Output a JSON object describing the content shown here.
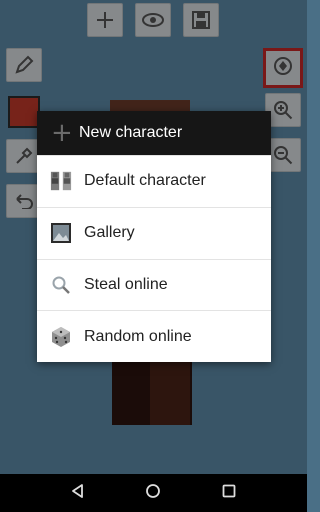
{
  "toolbar": {
    "top_icons": [
      "add-icon",
      "eye-icon",
      "save-icon"
    ],
    "left_icons": [
      "pencil-icon",
      "eyedropper-icon",
      "undo-icon"
    ],
    "right_icons": [
      "rotate-icon",
      "zoom-in-icon",
      "zoom-out-icon"
    ],
    "selected_color": "#c0392b"
  },
  "dialog": {
    "title": "New character",
    "items": [
      {
        "label": "Default character",
        "icon": "default-character-icon"
      },
      {
        "label": "Gallery",
        "icon": "gallery-icon"
      },
      {
        "label": "Steal online",
        "icon": "search-icon"
      },
      {
        "label": "Random online",
        "icon": "dice-icon"
      }
    ]
  },
  "navbar": {
    "buttons": [
      "back-icon",
      "home-icon",
      "recents-icon"
    ]
  }
}
